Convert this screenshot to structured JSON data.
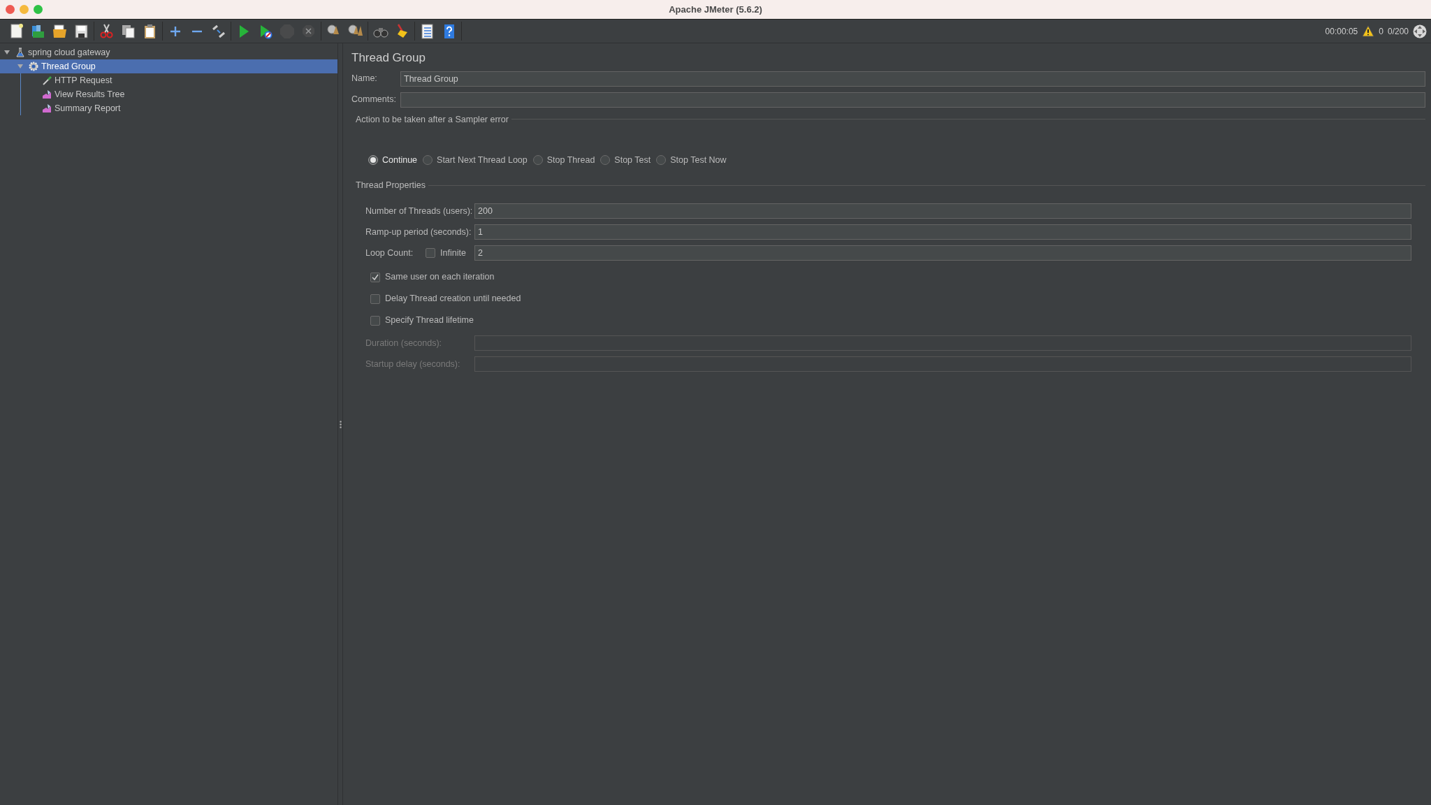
{
  "window": {
    "title": "Apache JMeter (5.6.2)"
  },
  "toolbar": [
    [
      {
        "kind": "new",
        "disabled": false
      },
      {
        "kind": "templates",
        "disabled": false
      },
      {
        "kind": "open",
        "disabled": false
      },
      {
        "kind": "save",
        "disabled": false
      }
    ],
    [
      {
        "kind": "cut",
        "disabled": false
      },
      {
        "kind": "copy",
        "disabled": false
      },
      {
        "kind": "paste",
        "disabled": false
      }
    ],
    [
      {
        "kind": "expand",
        "disabled": false
      },
      {
        "kind": "collapse",
        "disabled": false
      },
      {
        "kind": "toggle",
        "disabled": false
      }
    ],
    [
      {
        "kind": "start",
        "disabled": false
      },
      {
        "kind": "start_no_timers",
        "disabled": false
      },
      {
        "kind": "stop",
        "disabled": true
      },
      {
        "kind": "shutdown",
        "disabled": true
      }
    ],
    [
      {
        "kind": "clear",
        "disabled": false
      },
      {
        "kind": "clear_all",
        "disabled": false
      }
    ],
    [
      {
        "kind": "search",
        "disabled": false
      },
      {
        "kind": "reset_search",
        "disabled": false
      }
    ],
    [
      {
        "kind": "function_helper",
        "disabled": false
      },
      {
        "kind": "help",
        "disabled": false
      }
    ]
  ],
  "status": {
    "elapsed": "00:00:05",
    "warnings": "0",
    "threads": "0/200"
  },
  "tree": [
    {
      "label": "spring cloud gateway",
      "kind": "test_plan",
      "selected": false,
      "expanded": true,
      "children": [
        {
          "label": "Thread Group",
          "kind": "thread_group",
          "selected": true,
          "expanded": true,
          "children": [
            {
              "label": "HTTP Request",
              "kind": "sampler",
              "selected": false
            },
            {
              "label": "View Results Tree",
              "kind": "listener",
              "selected": false
            },
            {
              "label": "Summary Report",
              "kind": "listener",
              "selected": false
            }
          ]
        }
      ]
    }
  ],
  "panel": {
    "title": "Thread Group",
    "name": {
      "label": "Name:",
      "value": "Thread Group"
    },
    "comments": {
      "label": "Comments:"
    },
    "sampler_error": {
      "legend": "Action to be taken after a Sampler error",
      "options": [
        {
          "label": "Continue",
          "selected": true
        },
        {
          "label": "Start Next Thread Loop",
          "selected": false
        },
        {
          "label": "Stop Thread",
          "selected": false
        },
        {
          "label": "Stop Test",
          "selected": false
        },
        {
          "label": "Stop Test Now",
          "selected": false
        }
      ]
    },
    "thread_properties": {
      "legend": "Thread Properties",
      "threads": {
        "label": "Number of Threads (users):",
        "value": "200"
      },
      "ramp_up": {
        "label": "Ramp-up period (seconds):",
        "value": "1"
      },
      "loop_count": {
        "label": "Loop Count:",
        "infinite_label": "Infinite",
        "infinite": false,
        "value": "2"
      },
      "checkboxes": [
        {
          "label": "Same user on each iteration",
          "checked": true
        },
        {
          "label": "Delay Thread creation until needed",
          "checked": false
        },
        {
          "label": "Specify Thread lifetime",
          "checked": false
        }
      ],
      "lifetime_fields": [
        {
          "label": "Duration (seconds):",
          "disabled": true
        },
        {
          "label": "Startup delay (seconds):",
          "disabled": true
        }
      ]
    }
  }
}
